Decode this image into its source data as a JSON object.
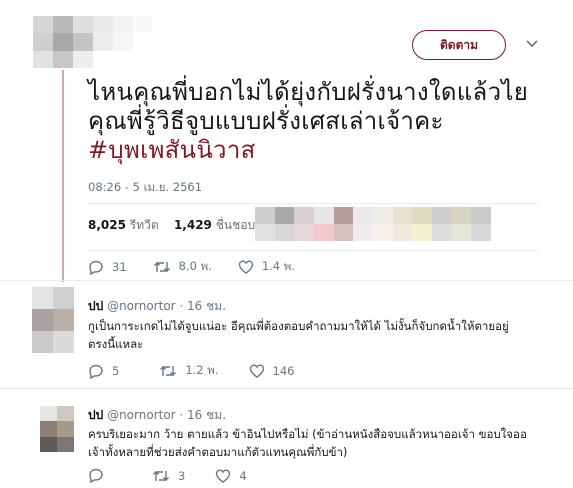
{
  "main_tweet": {
    "follow_label": "ติดตาม",
    "text_line1": "ไหนคุณพี่บอกไม่ได้ยุ่งกับฝรั่งนางใดแล้วไย",
    "text_line2": "คุณพี่รู้วิธีจูบแบบฝรั่งเศสเล่าเจ้าคะ",
    "hashtag": "#บุพเพสันนิวาส",
    "timestamp": "08:26 - 5 เม.ย. 2561",
    "retweet_count": "8,025",
    "retweet_label": "รีทวีต",
    "like_count": "1,429",
    "like_label": "ชื่นชอบ",
    "actions": {
      "replies": "31",
      "retweets": "8.0 พ.",
      "likes": "1.4 พ."
    }
  },
  "replies": [
    {
      "name": "ปป",
      "handle": "@nornortor",
      "time": "· 16 ชม.",
      "text_line1": "กูเป็นการะเกดไม่ได้จูบแน่อะ อีคุณพี่ต้องตอบคำถามมาให้ได้ ไม่งั้นก็จับกดน้ำให้ตายอยู่",
      "text_line2": "ตรงนี้แหละ",
      "actions": {
        "replies": "5",
        "retweets": "1.2 พ.",
        "likes": "146"
      }
    },
    {
      "name": "ปป",
      "handle": "@nornortor",
      "time": "· 16 ชม.",
      "text_line1": "ครบริเยอะมาก ว้าย ตายแล้ว ข้าอินไปหรือไม่ (ข้าอ่านหนังสือจบแล้วหนาออเจ้า ขอบใจออ",
      "text_line2": "เจ้าทั้งหลายที่ช่วยส่งคำตอบมาแก้ตัวแทนคุณพี่กับข้า)",
      "actions": {
        "replies": "",
        "retweets": "3",
        "likes": "4"
      }
    }
  ],
  "colors": {
    "accent": "#7d1a24",
    "muted": "#657786",
    "separator": "#e6ecf0"
  }
}
